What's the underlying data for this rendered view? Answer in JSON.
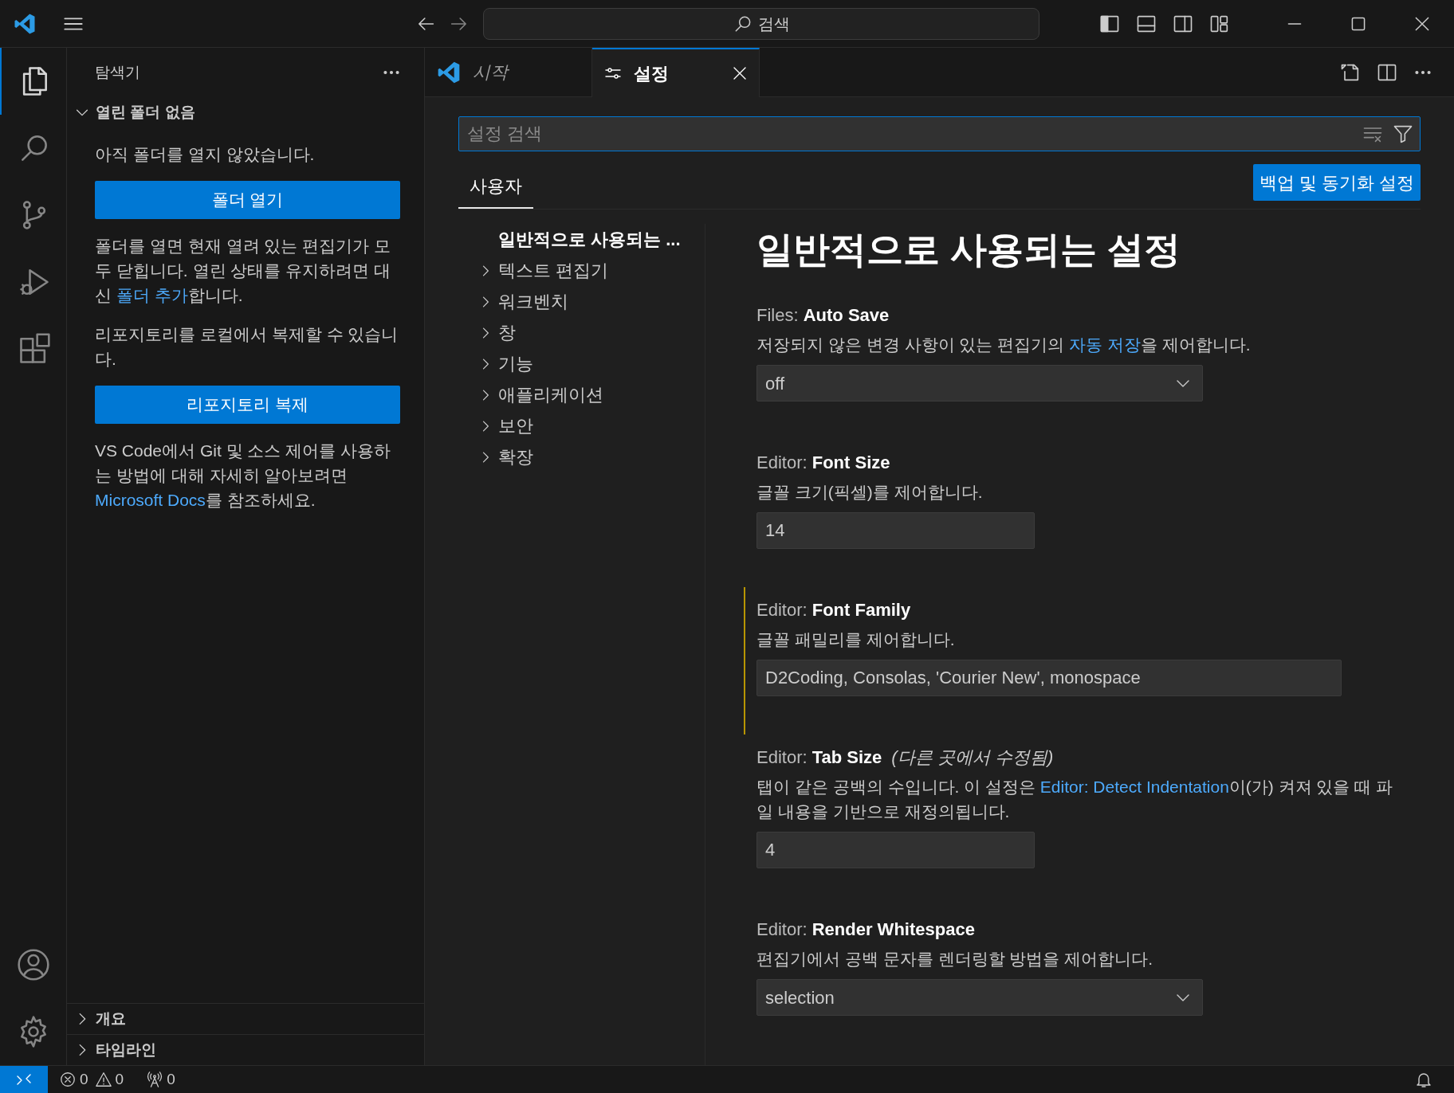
{
  "title_bar": {
    "search": "검색"
  },
  "activity_bar": {
    "items": [
      {
        "selected": true
      },
      {
        "selected": false
      },
      {
        "selected": false
      },
      {
        "selected": false
      },
      {
        "selected": false
      }
    ]
  },
  "sidebar": {
    "title": "탐색기",
    "section": {
      "title": "열린 폴더 없음",
      "expanded": true
    },
    "blocks": [
      {
        "kind": "text",
        "before": "아직 폴더를 열지 않았습니다."
      },
      {
        "kind": "button",
        "label": "폴더 열기"
      },
      {
        "kind": "text",
        "before": "폴더를 열면 현재 열려 있는 편집기가 모두 닫힙니다. 열린 상태를 유지하려면 대신 ",
        "link": "폴더 추가",
        "after": "합니다."
      },
      {
        "kind": "text",
        "before": "리포지토리를 로컬에서 복제할 수 있습니다."
      },
      {
        "kind": "button",
        "label": "리포지토리 복제"
      },
      {
        "kind": "text",
        "before": "VS Code에서 Git 및 소스 제어를 사용하는 방법에 대해 자세히 알아보려면 ",
        "link": "Microsoft Docs",
        "after": "를 참조하세요."
      }
    ],
    "panels": [
      {
        "title": "개요",
        "expanded": false
      },
      {
        "title": "타임라인",
        "expanded": false
      }
    ]
  },
  "tabs": [
    {
      "label": "시작",
      "selected": false,
      "closable": false
    },
    {
      "label": "설정",
      "selected": true,
      "closable": true
    }
  ],
  "settings": {
    "search": {
      "placeholder": "설정 검색"
    },
    "scope_tabs": [
      {
        "label": "사용자",
        "selected": true
      }
    ],
    "sync_button": "백업 및 동기화 설정",
    "toc": [
      {
        "label": "일반적으로 사용되는 ...",
        "selected": true,
        "has_children": false
      },
      {
        "label": "텍스트 편집기",
        "selected": false,
        "has_children": true
      },
      {
        "label": "워크벤치",
        "selected": false,
        "has_children": true
      },
      {
        "label": "창",
        "selected": false,
        "has_children": true
      },
      {
        "label": "기능",
        "selected": false,
        "has_children": true
      },
      {
        "label": "애플리케이션",
        "selected": false,
        "has_children": true
      },
      {
        "label": "보안",
        "selected": false,
        "has_children": true
      },
      {
        "label": "확장",
        "selected": false,
        "has_children": true
      }
    ],
    "heading": "일반적으로 사용되는 설정",
    "items": [
      {
        "category": "Files:",
        "name": "Auto Save",
        "modified": false,
        "before": "저장되지 않은 변경 사항이 있는 편집기의 ",
        "link": "자동 저장",
        "after": "을 제어합니다.",
        "kind": "dropdown",
        "value": "off"
      },
      {
        "category": "Editor:",
        "name": "Font Size",
        "modified": false,
        "before": "글꼴 크기(픽셀)를 제어합니다.",
        "kind": "input",
        "value": "14"
      },
      {
        "category": "Editor:",
        "name": "Font Family",
        "modified": true,
        "before": "글꼴 패밀리를 제어합니다.",
        "kind": "wide-input",
        "value": "D2Coding, Consolas, 'Courier New', monospace"
      },
      {
        "category": "Editor:",
        "name": "Tab Size",
        "note": "(다른 곳에서 수정됨)",
        "modified": false,
        "before": "탭이 같은 공백의 수입니다. 이 설정은 ",
        "link": "Editor: Detect Indentation",
        "after": "이(가) 켜져 있을 때 파일 내용을 기반으로 재정의됩니다.",
        "kind": "input",
        "value": "4"
      },
      {
        "category": "Editor:",
        "name": "Render Whitespace",
        "modified": false,
        "before": "편집기에서 공백 문자를 렌더링할 방법을 제어합니다.",
        "kind": "dropdown",
        "value": "selection"
      }
    ]
  },
  "status_bar": {
    "errors": "0",
    "warnings": "0",
    "ports": "0"
  }
}
